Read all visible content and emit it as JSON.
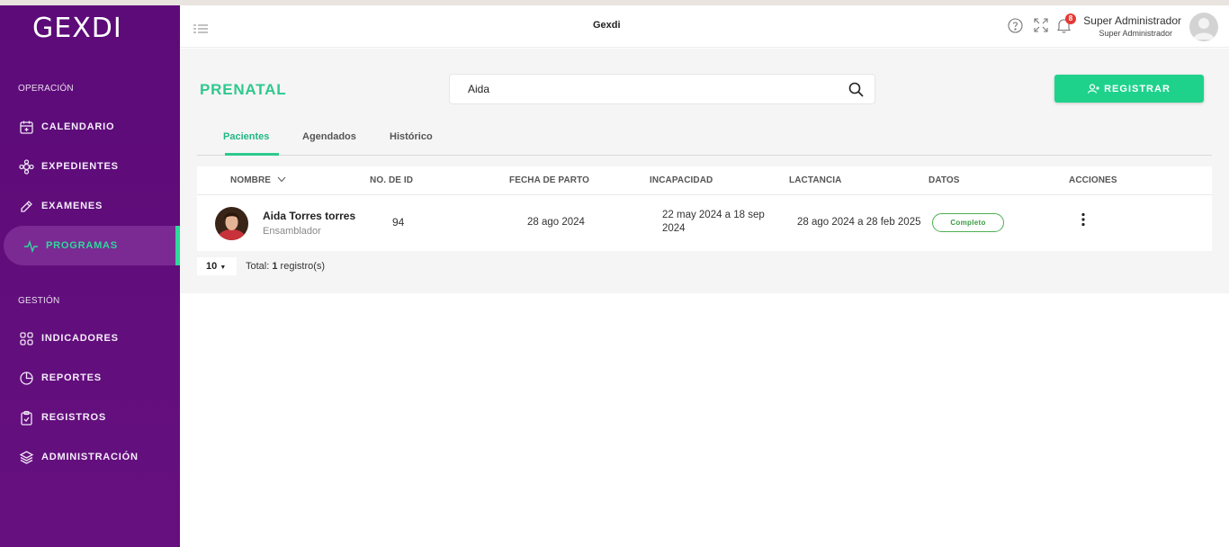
{
  "sidebar": {
    "logo": "GEXDI",
    "section_operacion": "OPERACIÓN",
    "section_gestion": "GESTIÓN",
    "items": [
      {
        "label": "CALENDARIO",
        "icon": "calendar-icon"
      },
      {
        "label": "EXPEDIENTES",
        "icon": "puzzle-icon"
      },
      {
        "label": "EXAMENES",
        "icon": "pencil-ruler-icon"
      },
      {
        "label": "PROGRAMAS",
        "icon": "pulse-icon",
        "active": true
      },
      {
        "label": "INDICADORES",
        "icon": "grid-icon"
      },
      {
        "label": "REPORTES",
        "icon": "pie-chart-icon"
      },
      {
        "label": "REGISTROS",
        "icon": "clipboard-icon"
      },
      {
        "label": "ADMINISTRACIÓN",
        "icon": "layers-icon"
      }
    ]
  },
  "header": {
    "title": "Gexdi",
    "notification_count": "8",
    "user_name": "Super Administrador",
    "user_role": "Super Administrador"
  },
  "page": {
    "title": "PRENATAL",
    "search_value": "Aida",
    "register_button": "REGISTRAR",
    "tabs": [
      "Pacientes",
      "Agendados",
      "Histórico"
    ],
    "active_tab": "Pacientes"
  },
  "table": {
    "columns": [
      "NOMBRE",
      "NO. DE ID",
      "FECHA DE PARTO",
      "INCAPACIDAD",
      "LACTANCIA",
      "DATOS",
      "ACCIONES"
    ],
    "rows": [
      {
        "name": "Aida Torres torres",
        "job": "Ensamblador",
        "id": "94",
        "birth_date": "28 ago 2024",
        "incapacity_line1": "22 may 2024 a 18 sep",
        "incapacity_line2": "2024",
        "lactation": "28 ago 2024 a 28 feb 2025",
        "status": "Completo"
      }
    ]
  },
  "pagination": {
    "page_size": "10",
    "total_prefix": "Total: ",
    "total_count": "1",
    "total_suffix": " registro(s)"
  },
  "colors": {
    "sidebar_bg": "#5c0b78",
    "accent_green": "#2ec98e",
    "button_green": "#1ed28c"
  }
}
